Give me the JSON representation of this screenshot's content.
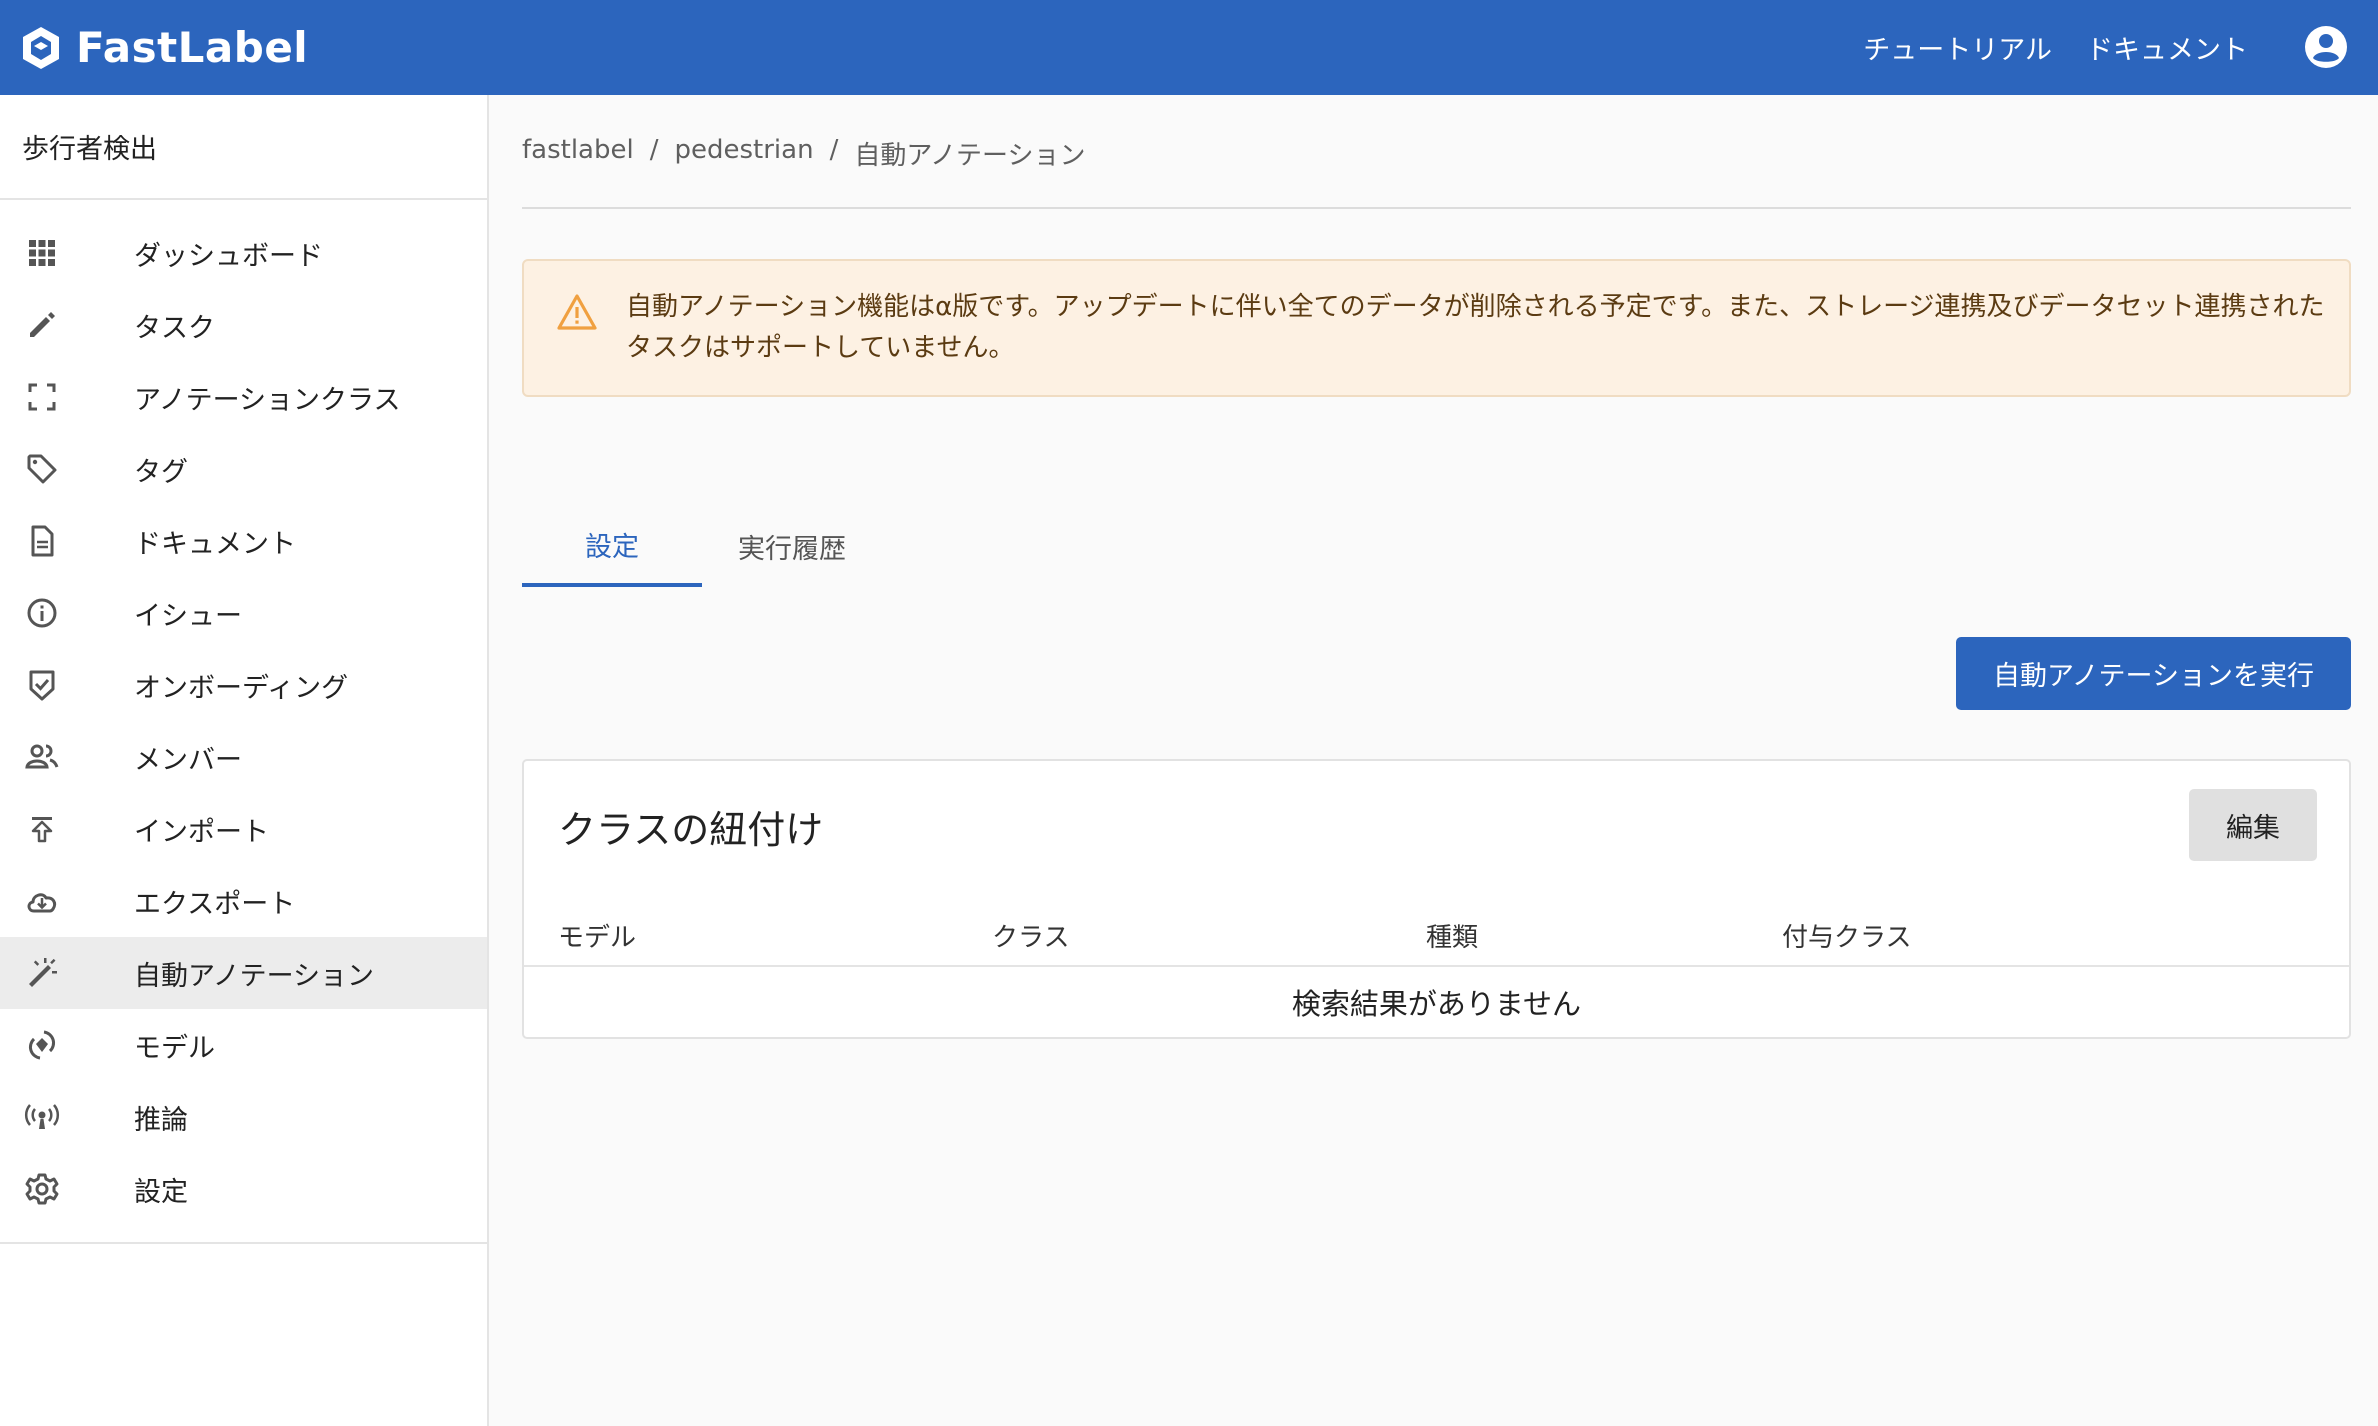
{
  "header": {
    "brand": "FastLabel",
    "links": [
      "チュートリアル",
      "ドキュメント"
    ]
  },
  "sidebar": {
    "project": "歩行者検出",
    "items": [
      {
        "label": "ダッシュボード",
        "icon": "dashboard-icon"
      },
      {
        "label": "タスク",
        "icon": "pencil-icon"
      },
      {
        "label": "アノテーションクラス",
        "icon": "frame-icon"
      },
      {
        "label": "タグ",
        "icon": "tag-icon"
      },
      {
        "label": "ドキュメント",
        "icon": "document-icon"
      },
      {
        "label": "イシュー",
        "icon": "info-icon"
      },
      {
        "label": "オンボーディング",
        "icon": "shield-check-icon"
      },
      {
        "label": "メンバー",
        "icon": "people-icon"
      },
      {
        "label": "インポート",
        "icon": "upload-icon"
      },
      {
        "label": "エクスポート",
        "icon": "cloud-download-icon"
      },
      {
        "label": "自動アノテーション",
        "icon": "magic-wand-icon",
        "active": true
      },
      {
        "label": "モデル",
        "icon": "model-icon"
      },
      {
        "label": "推論",
        "icon": "broadcast-icon"
      },
      {
        "label": "設定",
        "icon": "gear-icon"
      }
    ]
  },
  "breadcrumb": [
    "fastlabel",
    "pedestrian",
    "自動アノテーション"
  ],
  "alert": {
    "text": "自動アノテーション機能はα版です。アップデートに伴い全てのデータが削除される予定です。また、ストレージ連携及びデータセット連携されたタスクはサポートしていません。"
  },
  "tabs": [
    "設定",
    "実行履歴"
  ],
  "run_button": "自動アノテーションを実行",
  "card": {
    "title": "クラスの紐付け",
    "edit_button": "編集",
    "columns": [
      "モデル",
      "クラス",
      "種類",
      "付与クラス"
    ],
    "empty": "検索結果がありません"
  },
  "colors": {
    "primary": "#2c65bd",
    "alert_bg": "#fdf1e3",
    "alert_icon": "#f0a040"
  }
}
